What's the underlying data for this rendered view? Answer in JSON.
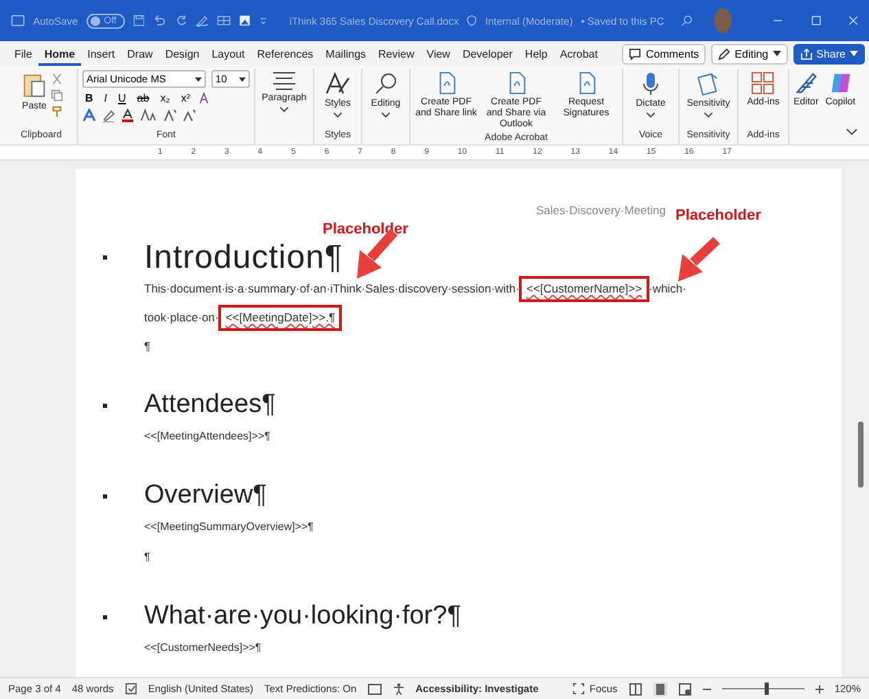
{
  "title_bar": {
    "autosave": {
      "label": "AutoSave",
      "on": false,
      "state_text": "Off"
    },
    "document_title": "iThink 365 Sales Discovery Call.docx",
    "sensitivity": "Internal (Moderate)",
    "save_status": "• Saved to this PC"
  },
  "menu_tabs": [
    {
      "label": "File",
      "selected": false
    },
    {
      "label": "Home",
      "selected": true
    },
    {
      "label": "Insert",
      "selected": false
    },
    {
      "label": "Draw",
      "selected": false
    },
    {
      "label": "Design",
      "selected": false
    },
    {
      "label": "Layout",
      "selected": false
    },
    {
      "label": "References",
      "selected": false
    },
    {
      "label": "Mailings",
      "selected": false
    },
    {
      "label": "Review",
      "selected": false
    },
    {
      "label": "View",
      "selected": false
    },
    {
      "label": "Developer",
      "selected": false
    },
    {
      "label": "Help",
      "selected": false
    },
    {
      "label": "Acrobat",
      "selected": false
    }
  ],
  "menu_actions": {
    "comments": "Comments",
    "editing": "Editing",
    "share": "Share"
  },
  "ribbon": {
    "clipboard": {
      "paste": "Paste",
      "label": "Clipboard"
    },
    "font": {
      "name": "Arial Unicode MS",
      "size": "10",
      "format_buttons": [
        "B",
        "I",
        "U",
        "ab",
        "x₂",
        "x²"
      ],
      "label": "Font"
    },
    "paragraph": {
      "button": "Paragraph"
    },
    "styles": {
      "button": "Styles",
      "label": "Styles"
    },
    "editing": {
      "button": "Editing"
    },
    "acrobat": {
      "buttons": [
        "Create PDF and Share link",
        "Create PDF and Share via Outlook",
        "Request Signatures"
      ],
      "label": "Adobe Acrobat"
    },
    "voice": {
      "button": "Dictate",
      "label": "Voice"
    },
    "sensitivity": {
      "button": "Sensitivity",
      "label": "Sensitivity"
    },
    "addins": {
      "button": "Add-ins",
      "label": "Add-ins"
    },
    "extras": [
      "Editor",
      "Copilot"
    ]
  },
  "ruler": [
    "1",
    "2",
    "3",
    "4",
    "5",
    "6",
    "7",
    "8",
    "9",
    "10",
    "11",
    "12",
    "13",
    "14",
    "15",
    "16",
    "17"
  ],
  "document": {
    "header": "Sales·Discovery·Meeting",
    "sections": [
      {
        "heading": "Introduction¶",
        "kind": "title",
        "paragraphs": [
          {
            "lines": [
              [
                {
                  "text": "This·document·is·a·summary·of·an·iThink·Sales·discovery·session·with·",
                  "highlighted": false
                },
                {
                  "text": "<<[CustomerName]>>",
                  "highlighted": true
                },
                {
                  "text": "·which·",
                  "highlighted": false
                }
              ],
              [
                {
                  "text": "took·place·on·",
                  "highlighted": false
                },
                {
                  "text": "<<[MeetingDate]>>.¶",
                  "highlighted": true
                }
              ]
            ]
          },
          {
            "lines": [
              [
                {
                  "text": "¶",
                  "highlighted": false
                }
              ]
            ]
          }
        ]
      },
      {
        "heading": "Attendees¶",
        "kind": "heading",
        "paragraphs": [
          {
            "lines": [
              [
                {
                  "text": "<<[MeetingAttendees]>>¶",
                  "highlighted": false
                }
              ]
            ]
          }
        ]
      },
      {
        "heading": "Overview¶",
        "kind": "heading",
        "paragraphs": [
          {
            "lines": [
              [
                {
                  "text": "<<[MeetingSummaryOverview]>>¶",
                  "highlighted": false
                }
              ]
            ]
          },
          {
            "lines": [
              [
                {
                  "text": "¶",
                  "highlighted": false
                }
              ]
            ]
          }
        ]
      },
      {
        "heading": "What·are·you·looking·for?¶",
        "kind": "heading",
        "paragraphs": [
          {
            "lines": [
              [
                {
                  "text": "<<[CustomerNeeds]>>¶",
                  "highlighted": false
                }
              ]
            ]
          }
        ]
      }
    ]
  },
  "callouts": [
    "Placeholder",
    "Placeholder"
  ],
  "status_bar": {
    "page": "Page 3 of 4",
    "words": "48 words",
    "language": "English (United States)",
    "predictions": "Text Predictions: On",
    "accessibility": "Accessibility: Investigate",
    "focus": "Focus",
    "zoom": {
      "level": 0.54,
      "reading": "120%"
    }
  }
}
